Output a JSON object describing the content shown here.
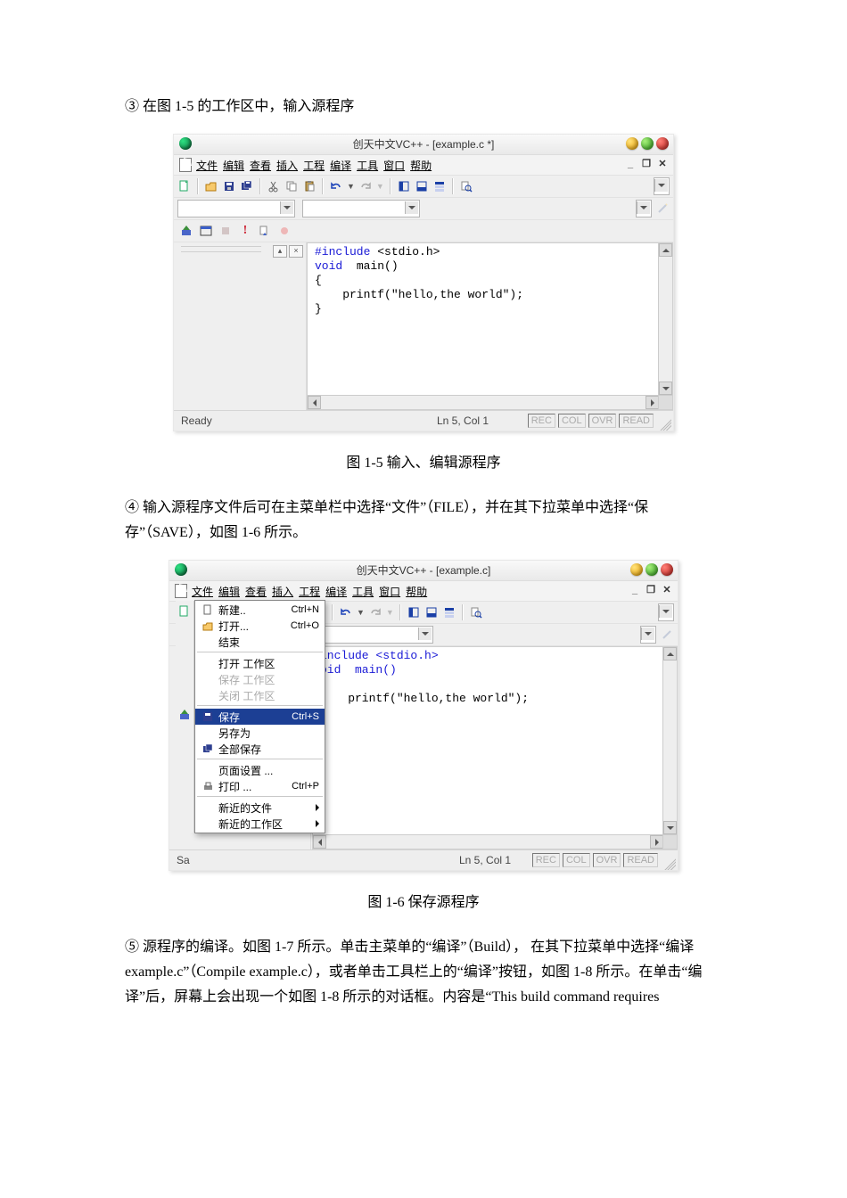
{
  "text": {
    "para3": "③ 在图 1-5 的工作区中，输入源程序",
    "caption1": "图 1-5  输入、编辑源程序",
    "para4": "④ 输入源程序文件后可在主菜单栏中选择“文件”（FILE），并在其下拉菜单中选择“保存”（SAVE），如图 1-6 所示。",
    "caption2": "图 1-6  保存源程序",
    "para5": "⑤ 源程序的编译。如图 1-7 所示。单击主菜单的“编译”（Build）， 在其下拉菜单中选择“编译 example.c”（Compile example.c），或者单击工具栏上的“编译”按钮，如图 1-8 所示。在单击“编译”后，屏幕上会出现一个如图 1-8 所示的对话框。内容是“This build command requires"
  },
  "ide1": {
    "title": "创天中文VC++ - [example.c *]",
    "menu": [
      "文件",
      "编辑",
      "查看",
      "插入",
      "工程",
      "编译",
      "工具",
      "窗口",
      "帮助"
    ],
    "status_left": "Ready",
    "status_center": "Ln 5, Col 1",
    "status_inds": [
      "REC",
      "COL",
      "OVR",
      "READ"
    ],
    "code_lines": {
      "l1a": "#include ",
      "l1b": "<stdio.h>",
      "l2a": "void",
      "l2b": "  main()",
      "l3": "{",
      "l4": "    printf(\"hello,the world\");",
      "l5": "}"
    }
  },
  "ide2": {
    "title": "创天中文VC++ - [example.c]",
    "menu": [
      "文件",
      "编辑",
      "查看",
      "插入",
      "工程",
      "编译",
      "工具",
      "窗口",
      "帮助"
    ],
    "status_left": "Sa",
    "status_center": "Ln 5, Col 1",
    "status_inds": [
      "REC",
      "COL",
      "OVR",
      "READ"
    ],
    "file_menu": {
      "new": {
        "label": "新建..",
        "accel": "Ctrl+N"
      },
      "open": {
        "label": "打开...",
        "accel": "Ctrl+O"
      },
      "end": {
        "label": "结束"
      },
      "openws": {
        "label": "打开 工作区"
      },
      "savews": {
        "label": "保存 工作区"
      },
      "closews": {
        "label": "关闭 工作区"
      },
      "save": {
        "label": "保存",
        "accel": "Ctrl+S"
      },
      "saveas": {
        "label": "另存为"
      },
      "saveall": {
        "label": "全部保存"
      },
      "pagesetup": {
        "label": "页面设置   ..."
      },
      "print": {
        "label": "打印 ...",
        "accel": "Ctrl+P"
      },
      "recentf": {
        "label": "新近的文件"
      },
      "recentw": {
        "label": "新近的工作区"
      }
    },
    "code_lines": {
      "l1": "include <stdio.h>",
      "l2": "oid  main()",
      "l4": "    printf(\"hello,the world\");"
    }
  }
}
